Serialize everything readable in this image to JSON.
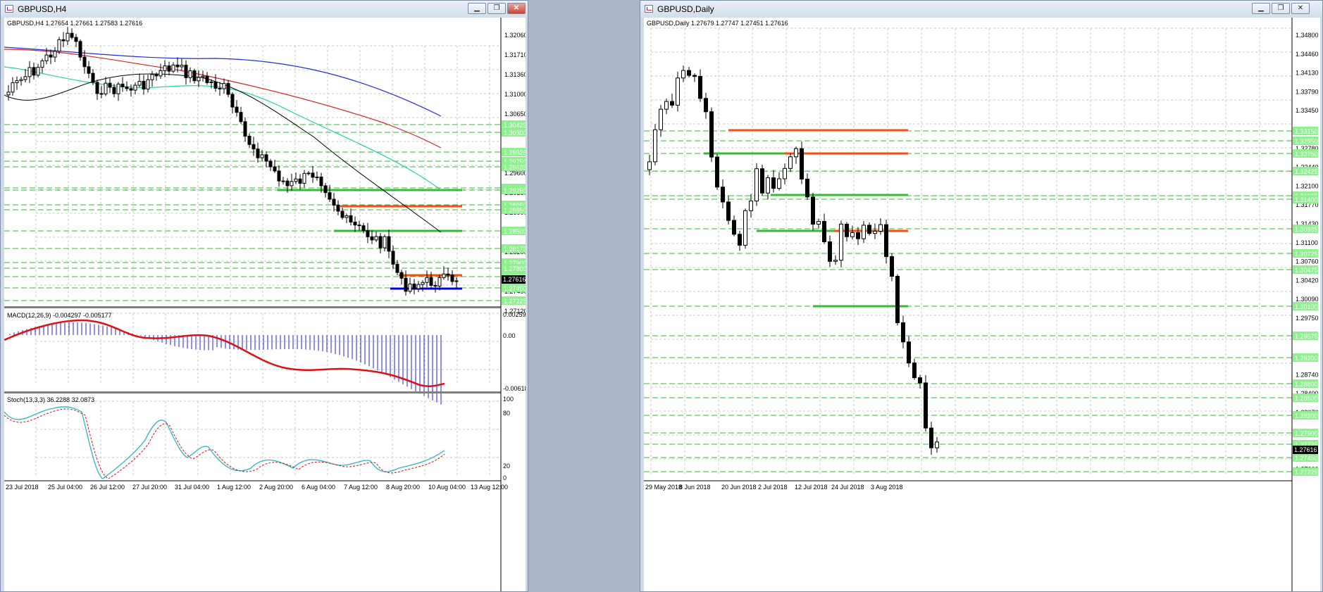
{
  "colors": {
    "grid": "#c8c8c8",
    "level_green": "#33bb33",
    "level_orange": "#ff4a10",
    "level_blue": "#0000e6",
    "ma_blue": "#1f2fd8",
    "ma_red": "#d82424",
    "ma_teal": "#22d4a0",
    "ma_black": "#000000",
    "macd_hist": "#2222cc",
    "macd_signal": "#e01010",
    "stoch_main": "#2bb7c4",
    "stoch_signal": "#e01010",
    "label_bg": "#8ef08e",
    "price_bg": "#000000"
  },
  "icons": {
    "window": "chart-window-icon",
    "minimize": "minimize-icon",
    "restore": "restore-icon",
    "close": "close-icon"
  },
  "windows": [
    {
      "title": "GBPUSD,H4",
      "buttons": {
        "minimize": "▁",
        "restore": "❐",
        "close": "✕"
      },
      "header": "GBPUSD,H4  1.27654 1.27661 1.27583 1.27616",
      "axis_labels": [
        "1.32060",
        "1.31710",
        "1.31360",
        "1.31000",
        "1.30650",
        "1.30300",
        "1.29950",
        "1.29600",
        "1.29250",
        "1.28900",
        "1.28550",
        "1.28200",
        "1.27850",
        "1.27490",
        "1.27120"
      ],
      "level_labels": [
        "1.30425",
        "1.30300",
        "1.29925",
        "1.29750",
        "1.29635",
        "1.29350",
        "1.29250",
        "1.28950",
        "1.28850",
        "1.28500",
        "1.28175",
        "1.27900",
        "1.27800",
        "1.27720",
        "1.27450",
        "1.27225"
      ],
      "current_price": "1.27616",
      "macd_label": "MACD(12,26,9) -0.004297 -0.005177",
      "macd_axis": [
        "0.002592",
        "0.00",
        "-0.006184"
      ],
      "stoch_label": "Stoch(13,3,3) 36.2288 32.0873",
      "stoch_axis": [
        "100",
        "80",
        "20",
        "0"
      ],
      "time_labels": [
        "23 Jul 2018",
        "25 Jul 04:00",
        "26 Jul 12:00",
        "27 Jul 20:00",
        "31 Jul 04:00",
        "1 Aug 12:00",
        "2 Aug 20:00",
        "6 Aug 04:00",
        "7 Aug 12:00",
        "8 Aug 20:00",
        "10 Aug 04:00",
        "13 Aug 12:00"
      ]
    },
    {
      "title": "GBPUSD,Daily",
      "buttons": {
        "minimize": "▁",
        "restore": "❐",
        "close": "✕"
      },
      "header": "GBPUSD,Daily  1.27679 1.27747 1.27451 1.27616",
      "axis_labels": [
        "1.34800",
        "1.34460",
        "1.34130",
        "1.33790",
        "1.33450",
        "1.33110",
        "1.32780",
        "1.32440",
        "1.32100",
        "1.31770",
        "1.31430",
        "1.31100",
        "1.30760",
        "1.30420",
        "1.30090",
        "1.29750",
        "1.29410",
        "1.29080",
        "1.28740",
        "1.28400",
        "1.28070",
        "1.27730",
        "1.27390",
        "1.27060"
      ],
      "level_labels": [
        "1.33150",
        "1.32950",
        "1.32750",
        "1.32425",
        "1.31385",
        "1.31400",
        "1.30985",
        "1.30725",
        "1.30475",
        "1.30100",
        "1.29575",
        "1.29200",
        "1.28800",
        "1.28500",
        "1.28200",
        "1.27900",
        "1.27725",
        "1.27450",
        "1.27225"
      ],
      "current_price": "1.27616",
      "time_labels": [
        "29 May 2018",
        "8 Jun 2018",
        "20 Jun 2018",
        "2 Jul 2018",
        "12 Jul 2018",
        "24 Jul 2018",
        "3 Aug 2018"
      ]
    }
  ]
}
